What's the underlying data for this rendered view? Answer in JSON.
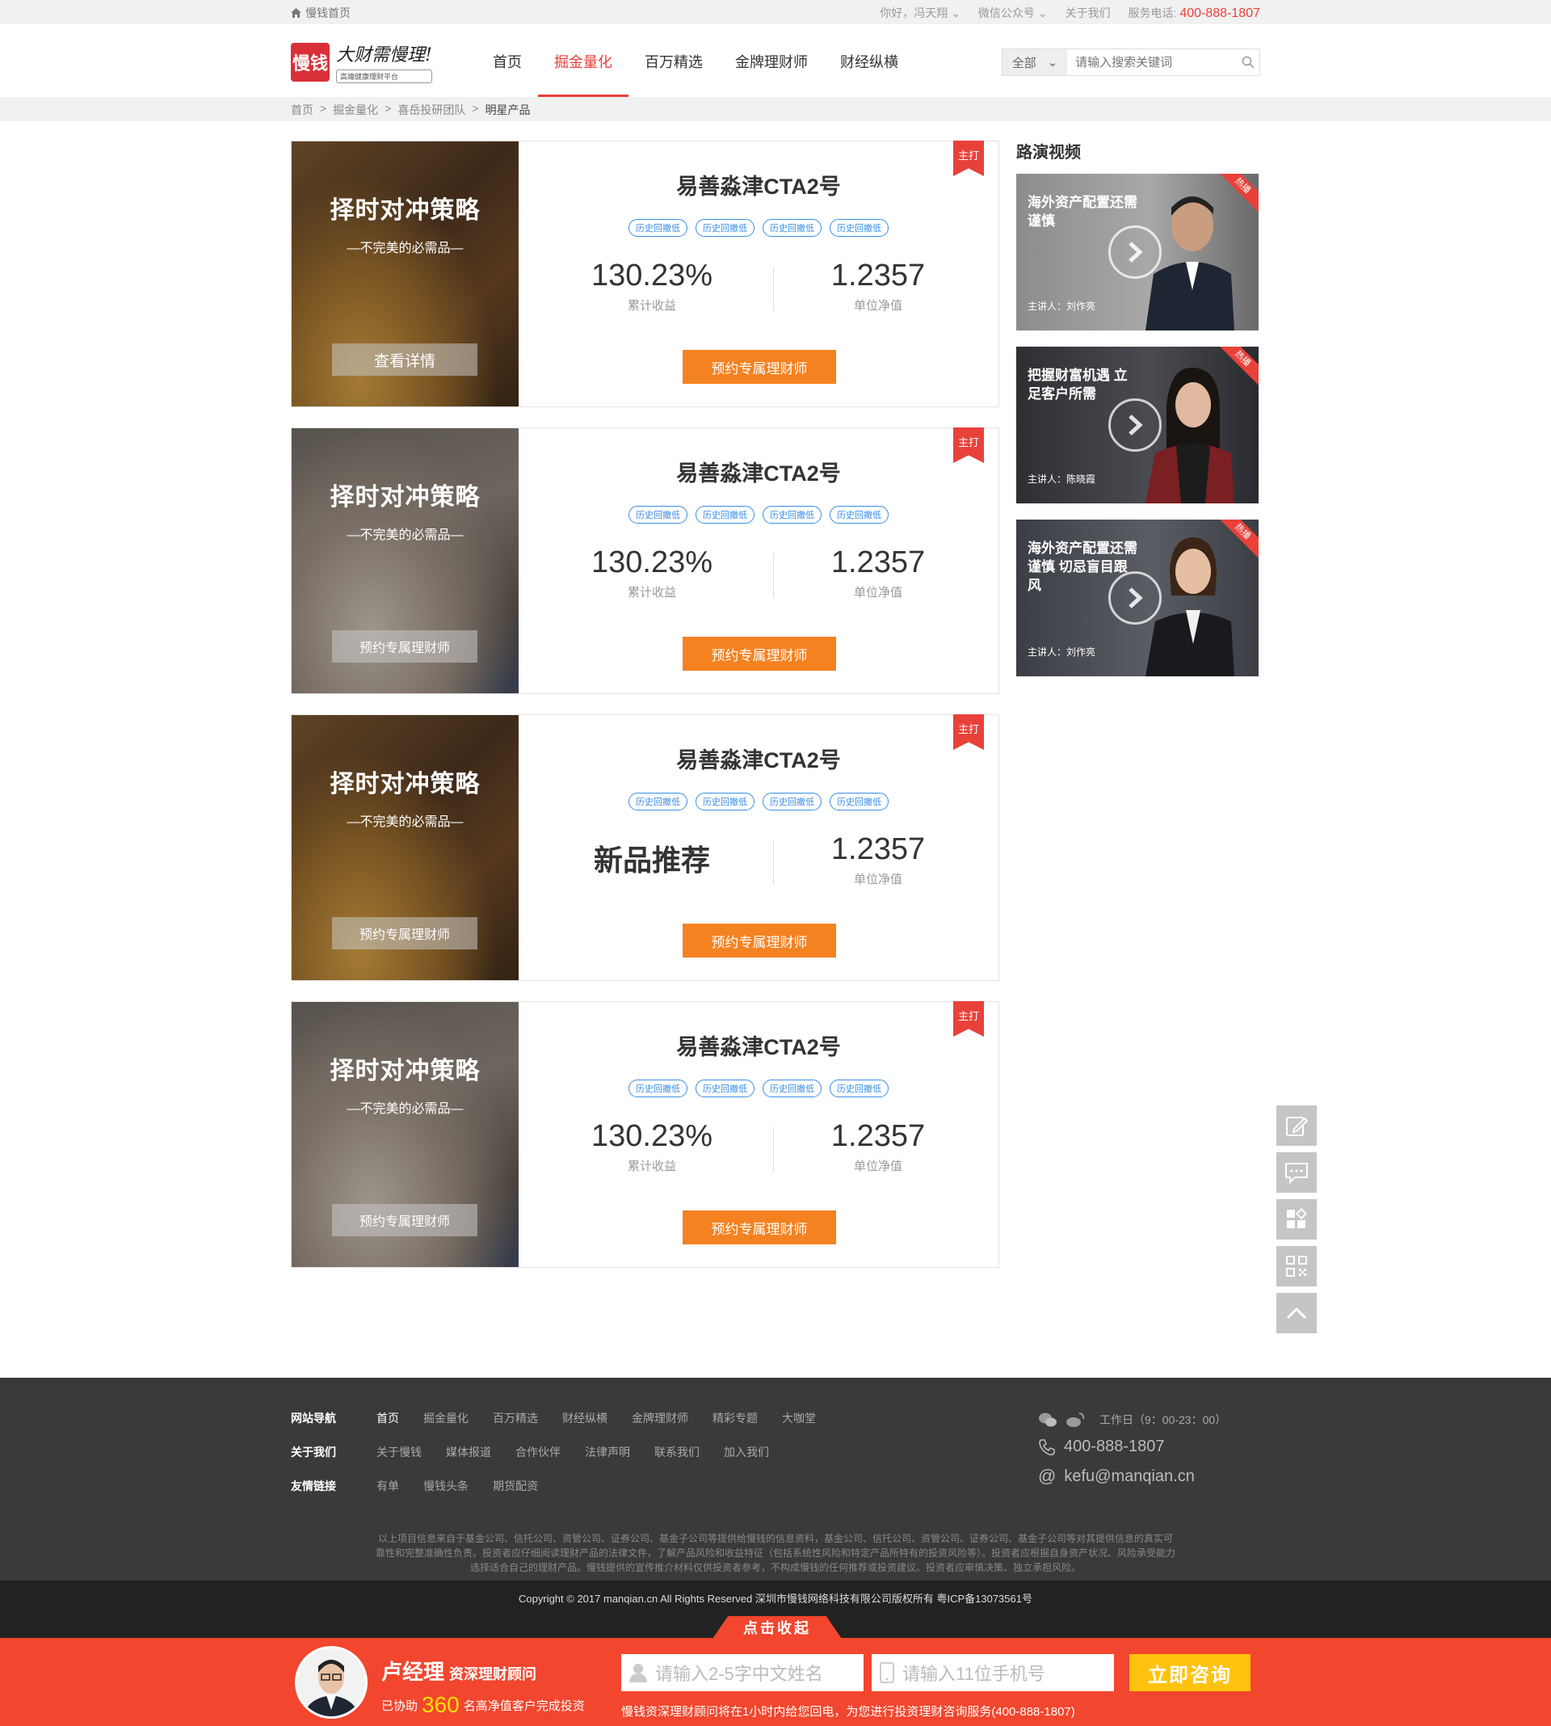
{
  "topbar": {
    "home_label": "慢钱首页",
    "greeting": "你好，冯天翔",
    "wechat": "微信公众号",
    "about": "关于我们",
    "service_label": "服务电话:",
    "phone": "400-888-1807"
  },
  "header": {
    "logo_badge": "慢钱",
    "logo_slogan": "大财需慢理!",
    "logo_sub": "高端健康理财平台",
    "nav": [
      "首页",
      "掘金量化",
      "百万精选",
      "金牌理财师",
      "财经纵横"
    ],
    "active_nav": "掘金量化",
    "search_scope": "全部",
    "search_placeholder": "请输入搜索关键词"
  },
  "breadcrumb": [
    "首页",
    "掘金量化",
    "喜岳投研团队",
    "明星产品"
  ],
  "products": [
    {
      "banner_title": "择时对冲策略",
      "banner_sub": "—不完美的必需品—",
      "banner_button": "查看详情",
      "name": "易善淼津CTA2号",
      "tags": [
        "历史回撤低",
        "历史回撤低",
        "历史回撤低",
        "历史回撤低"
      ],
      "metric_left_value": "130.23%",
      "metric_left_label": "累计收益",
      "metric_right_value": "1.2357",
      "metric_right_label": "单位净值",
      "cta": "预约专属理财师",
      "ribbon": "主打"
    },
    {
      "banner_title": "择时对冲策略",
      "banner_sub": "—不完美的必需品—",
      "banner_button": "预约专属理财师",
      "name": "易善淼津CTA2号",
      "tags": [
        "历史回撤低",
        "历史回撤低",
        "历史回撤低",
        "历史回撤低"
      ],
      "metric_left_value": "130.23%",
      "metric_left_label": "累计收益",
      "metric_right_value": "1.2357",
      "metric_right_label": "单位净值",
      "cta": "预约专属理财师",
      "ribbon": "主打"
    },
    {
      "banner_title": "择时对冲策略",
      "banner_sub": "—不完美的必需品—",
      "banner_button": "预约专属理财师",
      "name": "易善淼津CTA2号",
      "tags": [
        "历史回撤低",
        "历史回撤低",
        "历史回撤低",
        "历史回撤低"
      ],
      "metric_left_value": "新品推荐",
      "metric_left_label": "",
      "metric_right_value": "1.2357",
      "metric_right_label": "单位净值",
      "cta": "预约专属理财师",
      "ribbon": "主打"
    },
    {
      "banner_title": "择时对冲策略",
      "banner_sub": "—不完美的必需品—",
      "banner_button": "预约专属理财师",
      "name": "易善淼津CTA2号",
      "tags": [
        "历史回撤低",
        "历史回撤低",
        "历史回撤低",
        "历史回撤低"
      ],
      "metric_left_value": "130.23%",
      "metric_left_label": "累计收益",
      "metric_right_value": "1.2357",
      "metric_right_label": "单位净值",
      "cta": "预约专属理财师",
      "ribbon": "主打"
    }
  ],
  "videos_title": "路演视频",
  "videos": [
    {
      "title": "海外资产配置还需谨慎",
      "speaker": "主讲人：刘作亮",
      "badge": "热播"
    },
    {
      "title": "把握财富机遇 立足客户所需",
      "speaker": "主讲人：陈晓霞",
      "badge": "热播"
    },
    {
      "title": "海外资产配置还需谨慎 切忌盲目跟风",
      "speaker": "主讲人：刘作亮",
      "badge": "热播"
    }
  ],
  "float_icons": [
    "edit-icon",
    "chat-icon",
    "apps-icon",
    "qrcode-icon",
    "back-to-top-icon"
  ],
  "footer": {
    "nav_label": "网站导航",
    "nav_links": [
      "首页",
      "掘金量化",
      "百万精选",
      "财经纵横",
      "金牌理财师",
      "精彩专题",
      "大咖堂"
    ],
    "about_label": "关于我们",
    "about_links": [
      "关于慢钱",
      "媒体报道",
      "合作伙伴",
      "法律声明",
      "联系我们",
      "加入我们"
    ],
    "friends_label": "友情链接",
    "friend_links": [
      "有单",
      "慢钱头条",
      "期货配资"
    ],
    "work_hours": "工作日（9：00-23：00）",
    "phone": "400-888-1807",
    "email": "kefu@manqian.cn",
    "disclaimer": "以上项目信息来自于基金公司、信托公司、资管公司、证券公司、基金子公司等提供给慢钱的信息资料，基金公司、信托公司、资管公司、证券公司、基金子公司等对其提供信息的真实可靠性和完整准确性负责。投资者应仔细阅读理财产品的法律文件，了解产品风险和收益特征（包括系统性风险和特定产品所特有的投资风险等）。投资者应根据自身资产状况、风险承受能力选择适合自己的理财产品。慢钱提供的宣传推介材料仅供投资者参考，不构成慢钱的任何推荐或投资建议。投资者应审慎决策、独立承担风险。",
    "copyright": "Copyright © 2017 manqian.cn All Rights Reserved 深圳市慢钱网络科技有限公司版权所有 粤ICP备13073561号"
  },
  "consult": {
    "collapse_label": "点击收起",
    "manager_name": "卢经理",
    "manager_title": "资深理财顾问",
    "helped_prefix": "已协助",
    "helped_count": "360",
    "helped_suffix": "名高净值客户完成投资",
    "name_placeholder": "请输入2-5字中文姓名",
    "phone_placeholder": "请输入11位手机号",
    "submit": "立即咨询",
    "note": "慢钱资深理财顾问将在1小时内给您回电，为您进行投资理财咨询服务(400-888-1807)"
  },
  "colors": {
    "brand_red": "#e8413a",
    "cta_orange": "#f58220",
    "tag_blue": "#3a8ee6",
    "bottom_bar": "#f2462e",
    "consult_yellow": "#ffc20e"
  }
}
